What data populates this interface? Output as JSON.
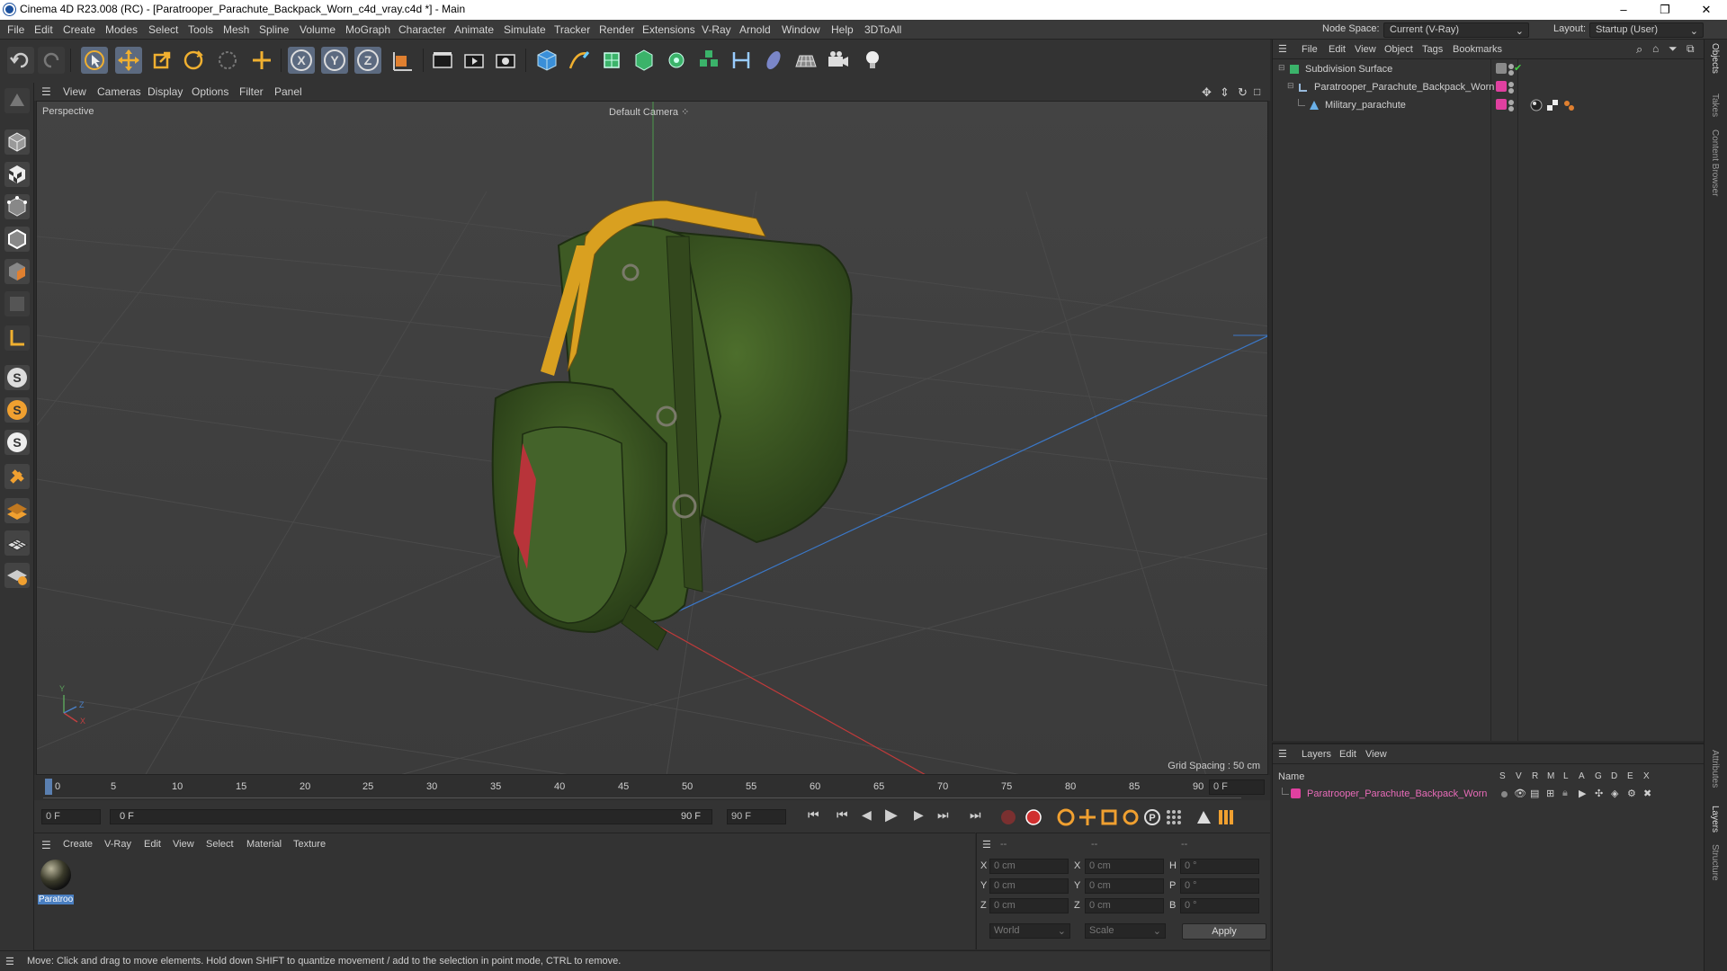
{
  "window": {
    "title": "Cinema 4D R23.008 (RC) - [Paratrooper_Parachute_Backpack_Worn_c4d_vray.c4d *] - Main",
    "minimize": "–",
    "maximize": "❐",
    "close": "✕"
  },
  "menubar": {
    "items": [
      "File",
      "Edit",
      "Create",
      "Modes",
      "Select",
      "Tools",
      "Mesh",
      "Spline",
      "Volume",
      "MoGraph",
      "Character",
      "Animate",
      "Simulate",
      "Tracker",
      "Render",
      "Extensions",
      "V-Ray",
      "Arnold",
      "Window",
      "Help",
      "3DToAll"
    ],
    "node_space_label": "Node Space:",
    "node_space_value": "Current (V-Ray)",
    "layout_label": "Layout:",
    "layout_value": "Startup (User)"
  },
  "viewport": {
    "menu": [
      "View",
      "Cameras",
      "Display",
      "Options",
      "Filter",
      "Panel"
    ],
    "view_name": "Perspective",
    "camera": "Default Camera",
    "grid_spacing": "Grid Spacing : 50 cm",
    "axis_y": "Y",
    "axis_z": "Z",
    "axis_x": "X"
  },
  "timeline": {
    "ticks": [
      "0",
      "5",
      "10",
      "15",
      "20",
      "25",
      "30",
      "35",
      "40",
      "45",
      "50",
      "55",
      "60",
      "65",
      "70",
      "75",
      "80",
      "85",
      "90"
    ],
    "current_frame": "0 F"
  },
  "playbar": {
    "start_field": "0 F",
    "range_start": "0 F",
    "range_end": "90 F",
    "end_field": "90 F"
  },
  "material_manager": {
    "menu": [
      "Create",
      "V-Ray",
      "Edit",
      "View",
      "Select",
      "Material",
      "Texture"
    ],
    "material_name": "Paratroo"
  },
  "coords": {
    "header_a": "--",
    "header_b": "--",
    "header_c": "--",
    "rows": [
      {
        "a_label": "X",
        "a_val": "0 cm",
        "b_label": "X",
        "b_val": "0 cm",
        "c_label": "H",
        "c_val": "0 °"
      },
      {
        "a_label": "Y",
        "a_val": "0 cm",
        "b_label": "Y",
        "b_val": "0 cm",
        "c_label": "P",
        "c_val": "0 °"
      },
      {
        "a_label": "Z",
        "a_val": "0 cm",
        "b_label": "Z",
        "b_val": "0 cm",
        "c_label": "B",
        "c_val": "0 °"
      }
    ],
    "world": "World",
    "scale": "Scale",
    "apply": "Apply"
  },
  "status": {
    "text": "Move: Click and drag to move elements. Hold down SHIFT to quantize movement / add to the selection in point mode, CTRL to remove."
  },
  "object_manager": {
    "menu": [
      "File",
      "Edit",
      "View",
      "Object",
      "Tags",
      "Bookmarks"
    ],
    "objects": [
      {
        "name": "Subdivision Surface"
      },
      {
        "name": "Paratrooper_Parachute_Backpack_Worn"
      },
      {
        "name": "Military_parachute"
      }
    ]
  },
  "layer_manager": {
    "menu": [
      "Layers",
      "Edit",
      "View"
    ],
    "name_header": "Name",
    "cols": [
      "S",
      "V",
      "R",
      "M",
      "L",
      "A",
      "G",
      "D",
      "E",
      "X"
    ],
    "layer_name": "Paratrooper_Parachute_Backpack_Worn"
  },
  "right_tabs": [
    "Objects",
    "Takes",
    "Content Browser",
    "Attributes",
    "Layers",
    "Structure"
  ],
  "colors": {
    "accent": "#4a7fc1",
    "layer_pink": "#e040a0",
    "model_green": "#3d5a24",
    "strap_yellow": "#d9a020"
  }
}
